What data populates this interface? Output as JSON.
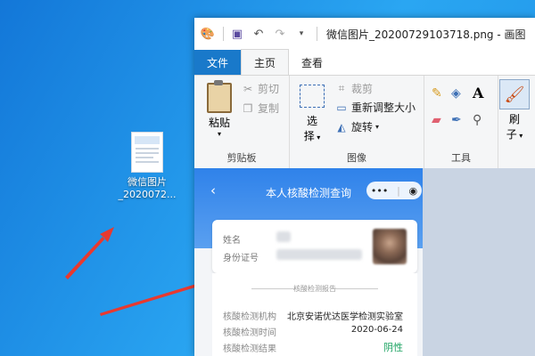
{
  "desktop": {
    "file_icon_label_1": "微信图片",
    "file_icon_label_2": "_2020072..."
  },
  "window": {
    "title": "微信图片_20200729103718.png - 画图",
    "quick_access": {
      "save_icon": "save-icon",
      "undo_icon": "undo-icon",
      "redo_icon": "redo-icon"
    }
  },
  "tabs": {
    "file": "文件",
    "home": "主页",
    "view": "查看"
  },
  "ribbon": {
    "clipboard": {
      "paste": "粘贴",
      "cut": "剪切",
      "copy": "复制",
      "group": "剪贴板"
    },
    "image": {
      "select_1": "选",
      "select_2": "择",
      "crop": "裁剪",
      "resize": "重新调整大小",
      "rotate": "旋转",
      "group": "图像"
    },
    "tools": {
      "group": "工具"
    },
    "brush": {
      "label_1": "刷",
      "label_2": "子"
    }
  },
  "phone": {
    "title": "本人核酸检测查询",
    "name_label": "姓名",
    "id_label": "身份证号",
    "report_header": "核酸检测报告",
    "rows": [
      {
        "label": "核酸检测机构",
        "value": "北京安诺优达医学检测实验室"
      },
      {
        "label": "核酸检测时间",
        "value": "2020-06-24"
      },
      {
        "label": "核酸检测结果",
        "value": "阴性"
      }
    ]
  },
  "colors": {
    "file_tab": "#1979ca",
    "arrow": "#e8392f",
    "result_negative": "#1aa260",
    "desktop": "#1a8fe3"
  }
}
